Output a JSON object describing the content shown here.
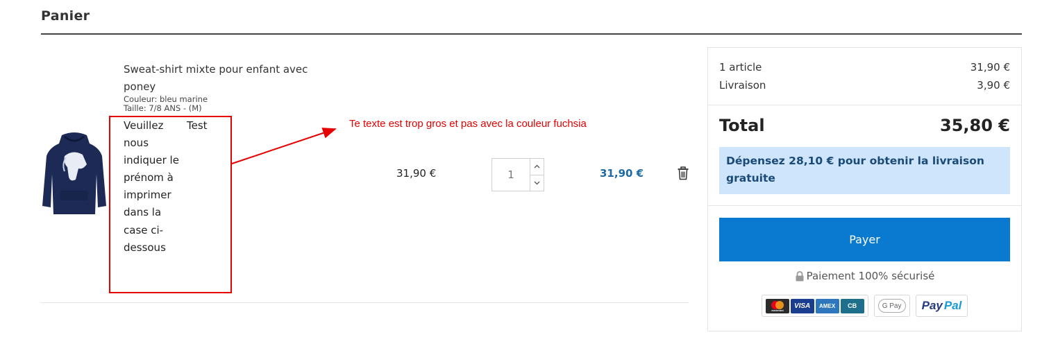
{
  "page": {
    "title": "Panier"
  },
  "cart_item": {
    "name": "Sweat-shirt mixte pour enfant avec poney",
    "color_attr": "Couleur: bleu marine",
    "size_attr": "Taille: 7/8 ANS - (M)",
    "custom_label": "Veuillez nous indiquer le prénom à imprimer dans la case ci-dessous",
    "custom_value": "Test",
    "unit_price": "31,90 €",
    "quantity": "1",
    "line_total": "31,90 €",
    "image_icon": "hoodie-image"
  },
  "annotation": {
    "text": "Te texte est trop gros et pas avec la couleur fuchsia",
    "color": "#e60000"
  },
  "summary": {
    "items_label": "1 article",
    "items_value": "31,90 €",
    "shipping_label": "Livraison",
    "shipping_value": "3,90 €",
    "total_label": "Total",
    "total_value": "35,80 €",
    "free_shipping_message": "Dépensez 28,10 € pour obtenir la livraison gratuite",
    "pay_button": "Payer",
    "secure_text": "Paiement 100% sécurisé",
    "card_logos": {
      "mastercard": "mastercard",
      "visa": "VISA",
      "amex": "AMEX",
      "cb": "CB"
    },
    "gpay": "G Pay",
    "paypal_1": "Pay",
    "paypal_2": "Pal"
  },
  "colors": {
    "accent": "#0a7ad1",
    "price_total": "#1d6aa5",
    "info_bg": "#cfe5fb"
  }
}
